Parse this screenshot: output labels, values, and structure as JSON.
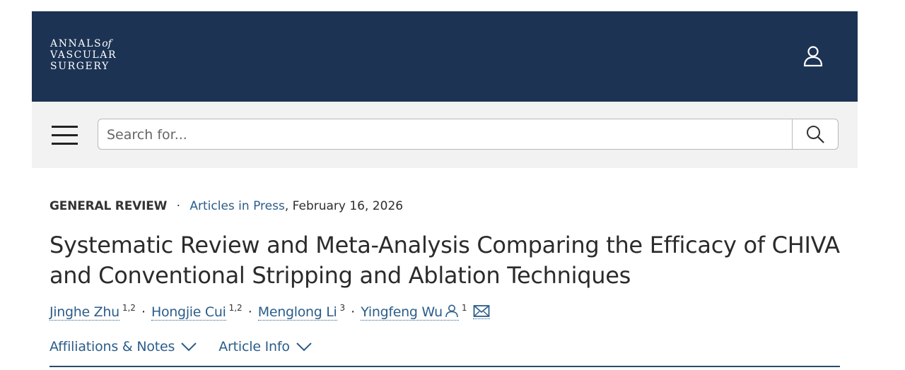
{
  "header": {
    "logo": {
      "line1": "ANNALS",
      "line1_of": "of",
      "line2": "VASCULAR",
      "line3": "SURGERY"
    },
    "user_icon": "user-icon",
    "background": "#1c3353"
  },
  "search": {
    "placeholder": "Search for...",
    "value": "",
    "menu_icon": "hamburger-menu-icon",
    "search_icon": "search-icon"
  },
  "article": {
    "type": "GENERAL REVIEW",
    "separator": "·",
    "section_link": "Articles in Press",
    "date": ", February 16, 2026",
    "title": "Systematic Review and Meta-Analysis Comparing the Efficacy of CHIVA and Conventional Stripping and Ablation Techniques",
    "authors": [
      {
        "name": "Jinghe Zhu",
        "affil": "1,2"
      },
      {
        "name": "Hongjie Cui",
        "affil": "1,2"
      },
      {
        "name": "Menglong Li",
        "affil": "3"
      },
      {
        "name": "Yingfeng Wu",
        "affil": "1",
        "corresponding": true
      }
    ],
    "author_separator": "·",
    "toggles": {
      "affiliations": "Affiliations & Notes",
      "article_info": "Article Info"
    },
    "link_color": "#2b5d8a"
  }
}
